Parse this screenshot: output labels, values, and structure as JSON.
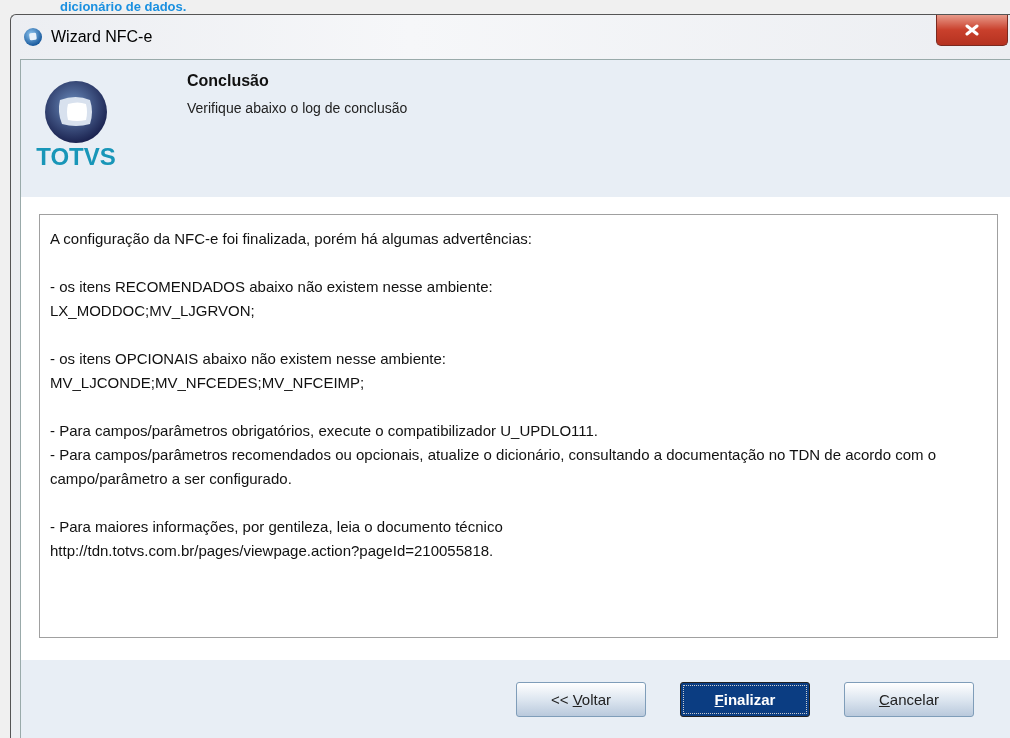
{
  "background_caption": "dicionário de dados.",
  "window": {
    "title": "Wizard NFC-e"
  },
  "header": {
    "logo_text": "TOTVS",
    "title": "Conclusão",
    "subtitle": "Verifique abaixo o log de conclusão"
  },
  "log": {
    "paragraphs": [
      [
        "A configuração da NFC-e foi finalizada, porém há algumas advertências:"
      ],
      [
        "- os itens RECOMENDADOS abaixo não existem nesse ambiente:",
        "LX_MODDOC;MV_LJGRVON;"
      ],
      [
        "- os itens OPCIONAIS abaixo não existem nesse ambiente:",
        "MV_LJCONDE;MV_NFCEDES;MV_NFCEIMP;"
      ],
      [
        "- Para campos/parâmetros obrigatórios, execute o compatibilizador U_UPDLO111.",
        "- Para campos/parâmetros recomendados ou opcionais, atualize o dicionário, consultando a documentação no TDN de acordo com o campo/parâmetro a ser configurado."
      ],
      [
        "- Para maiores informações, por gentileza, leia o documento técnico",
        "http://tdn.totvs.com.br/pages/viewpage.action?pageId=210055818."
      ]
    ]
  },
  "buttons": [
    {
      "before": "<< ",
      "key": "V",
      "after": "oltar",
      "default": false
    },
    {
      "key": "F",
      "after": "inalizar",
      "default": true
    },
    {
      "key": "C",
      "after": "ancelar",
      "default": false
    }
  ]
}
